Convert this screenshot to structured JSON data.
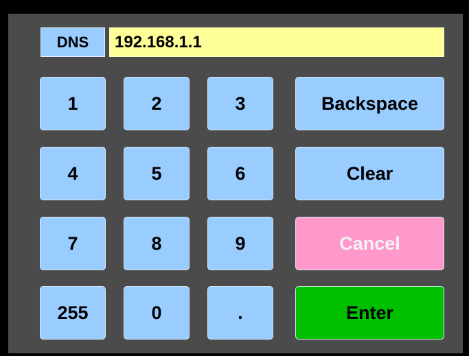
{
  "field": {
    "label": "DNS",
    "value": "192.168.1.1"
  },
  "keypad": {
    "k1": "1",
    "k2": "2",
    "k3": "3",
    "k4": "4",
    "k5": "5",
    "k6": "6",
    "k7": "7",
    "k8": "8",
    "k9": "9",
    "k255": "255",
    "k0": "0",
    "kdot": "."
  },
  "actions": {
    "backspace": "Backspace",
    "clear": "Clear",
    "cancel": "Cancel",
    "enter": "Enter"
  },
  "colors": {
    "background": "#4b4b4b",
    "key": "#99ccff",
    "display": "#ffff99",
    "cancel": "#ff99cc",
    "enter": "#00c000"
  }
}
